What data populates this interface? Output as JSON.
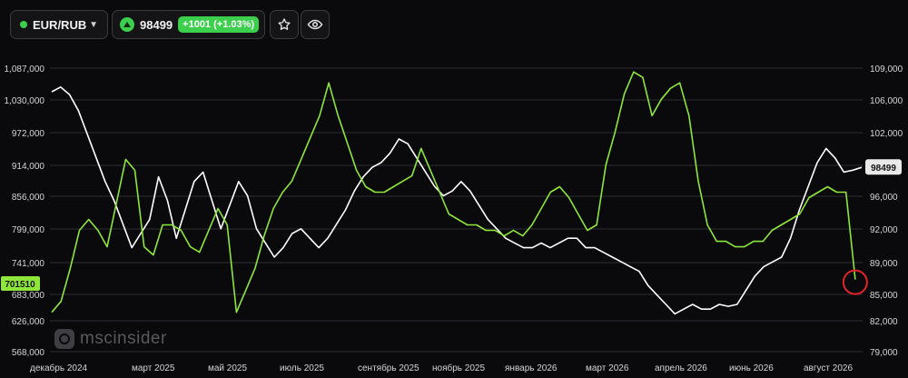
{
  "toolbar": {
    "pair": "EUR/RUB",
    "price": "98499",
    "change": "+1001 (+1.03%)",
    "colors": {
      "up": "#3ccf4e"
    }
  },
  "watermark": "mscinsider",
  "chart_data": {
    "type": "line",
    "x_tick_labels": [
      "декабрь 2024",
      "март 2025",
      "май 2025",
      "июль 2025",
      "сентябрь 2025",
      "ноябрь 2025",
      "январь 2026",
      "март 2026",
      "апрель 2026",
      "июнь 2026",
      "август 2026"
    ],
    "left_axis": {
      "ticks": [
        "1,087,000",
        "1,030,000",
        "972,000",
        "914,000",
        "856,000",
        "799,000",
        "741,000",
        "683,000",
        "626,000",
        "568,000"
      ],
      "range": [
        568000,
        1087000
      ]
    },
    "right_axis": {
      "ticks": [
        "109,000",
        "106,000",
        "102,000",
        "99,000",
        "96,000",
        "92,000",
        "89,000",
        "85,000",
        "82,000",
        "79,000"
      ],
      "range": [
        79000,
        109000
      ]
    },
    "grid": true,
    "last_value_labels": {
      "right": "98499",
      "left": "701510"
    },
    "series": [
      {
        "color": "#ffffff",
        "axis": "right",
        "values": [
          106.5,
          107.0,
          106.2,
          104.5,
          102.0,
          99.5,
          97.0,
          95.0,
          92.5,
          90.0,
          91.5,
          93.0,
          97.5,
          95.0,
          91.0,
          94.0,
          97.0,
          98.0,
          95.0,
          92.0,
          94.5,
          97.0,
          95.5,
          92.0,
          90.5,
          89.0,
          90.0,
          91.5,
          92.0,
          91.0,
          90.0,
          91.0,
          92.5,
          94.0,
          96.0,
          97.5,
          98.5,
          99.0,
          100.0,
          101.5,
          101.0,
          99.5,
          98.0,
          96.5,
          95.5,
          96.0,
          97.0,
          96.0,
          94.5,
          93.0,
          92.0,
          91.0,
          90.5,
          90.0,
          90.0,
          90.5,
          90.0,
          90.5,
          91.0,
          91.0,
          90.0,
          90.0,
          89.5,
          89.0,
          88.5,
          88.0,
          87.5,
          86.0,
          85.0,
          84.0,
          83.0,
          83.5,
          84.0,
          83.5,
          83.5,
          84.0,
          83.8,
          84.0,
          85.5,
          87.0,
          88.0,
          88.5,
          89.0,
          91.0,
          94.0,
          96.5,
          99.0,
          100.5,
          99.5,
          98.0,
          98.2,
          98.5
        ]
      },
      {
        "color": "#8ee63a",
        "axis": "left",
        "values": [
          640000,
          660000,
          720000,
          790000,
          810000,
          790000,
          760000,
          840000,
          920000,
          900000,
          760000,
          745000,
          800000,
          800000,
          790000,
          760000,
          750000,
          790000,
          830000,
          800000,
          640000,
          680000,
          720000,
          780000,
          830000,
          860000,
          880000,
          920000,
          960000,
          1000000,
          1060000,
          1000000,
          950000,
          900000,
          870000,
          860000,
          860000,
          870000,
          880000,
          890000,
          940000,
          900000,
          860000,
          820000,
          810000,
          800000,
          800000,
          790000,
          790000,
          780000,
          790000,
          780000,
          800000,
          830000,
          860000,
          870000,
          850000,
          820000,
          790000,
          800000,
          910000,
          970000,
          1040000,
          1080000,
          1070000,
          1000000,
          1030000,
          1050000,
          1060000,
          1000000,
          880000,
          800000,
          770000,
          770000,
          760000,
          760000,
          770000,
          770000,
          790000,
          800000,
          810000,
          820000,
          850000,
          860000,
          870000,
          860000,
          860000,
          700000
        ]
      }
    ]
  }
}
